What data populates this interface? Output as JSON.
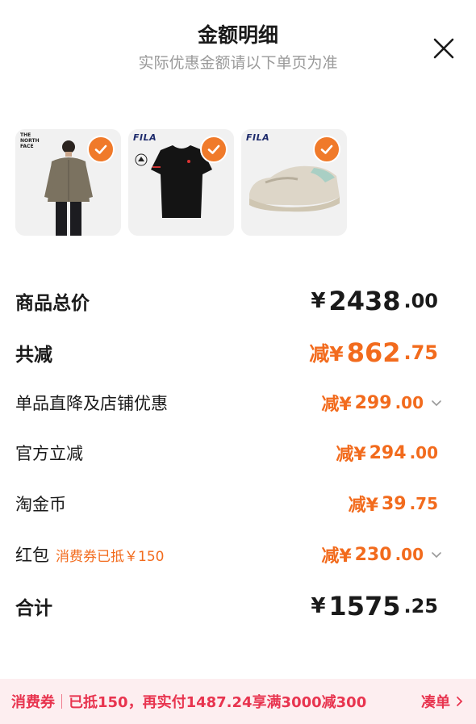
{
  "header": {
    "title": "金额明细",
    "subtitle": "实际优惠金额请以下单页为准"
  },
  "products": [
    {
      "brand": "THE NORTH FACE",
      "item": "fleece-jacket",
      "selected": true
    },
    {
      "brand": "FILA",
      "item": "black-tshirt",
      "selected": true
    },
    {
      "brand": "FILA",
      "item": "chunky-sneaker",
      "selected": true
    }
  ],
  "rows": {
    "total_price": {
      "label": "商品总价",
      "currency": "¥",
      "int": "2438",
      "dec": ".00"
    },
    "total_discount": {
      "label": "共减",
      "prefix": "减¥",
      "int": "862",
      "dec": ".75"
    },
    "store_discount": {
      "label": "单品直降及店铺优惠",
      "prefix": "减¥",
      "int": "299",
      "dec": ".00"
    },
    "official_discount": {
      "label": "官方立减",
      "prefix": "减¥",
      "int": "294",
      "dec": ".00"
    },
    "taojinbi": {
      "label": "淘金币",
      "prefix": "减¥",
      "int": "39",
      "dec": ".75"
    },
    "red_packet": {
      "label": "红包",
      "note": "消费券已抵￥150",
      "prefix": "减¥",
      "int": "230",
      "dec": ".00"
    },
    "subtotal": {
      "label": "合计",
      "currency": "¥",
      "int": "1575",
      "dec": ".25"
    }
  },
  "footer": {
    "tag": "消费券",
    "text": "已抵150，再实付1487.24享满3000减300",
    "action": "凑单"
  },
  "colors": {
    "accent_orange": "#f26b1d",
    "check_orange": "#f07a2a",
    "coupon_red": "#e8344f",
    "footer_bg": "#fdeef0"
  }
}
